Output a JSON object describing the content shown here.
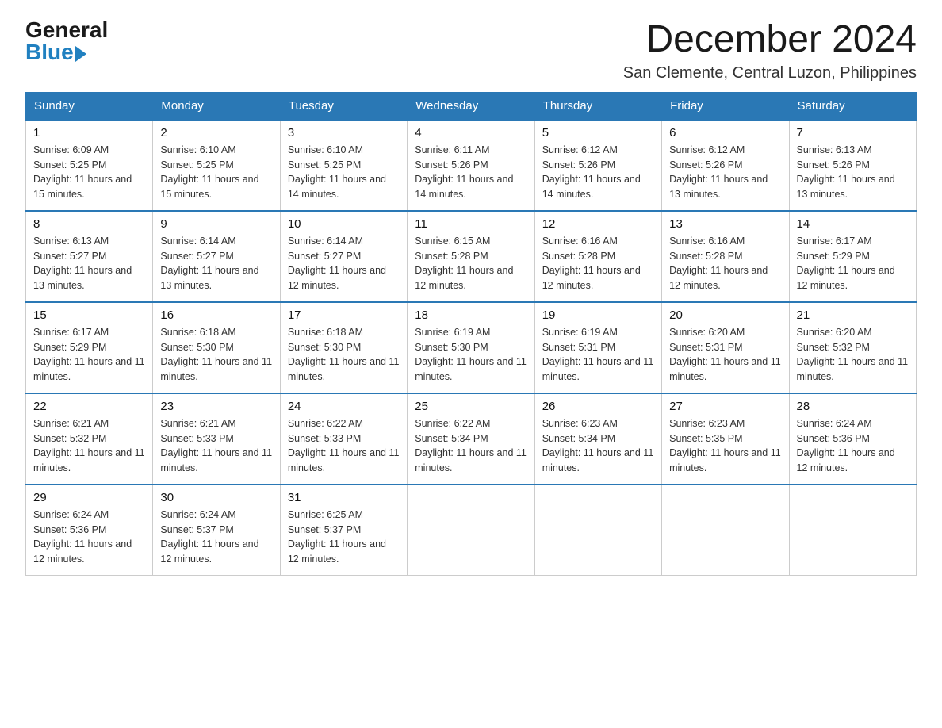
{
  "logo": {
    "general": "General",
    "blue": "Blue"
  },
  "header": {
    "month": "December 2024",
    "location": "San Clemente, Central Luzon, Philippines"
  },
  "weekdays": [
    "Sunday",
    "Monday",
    "Tuesday",
    "Wednesday",
    "Thursday",
    "Friday",
    "Saturday"
  ],
  "weeks": [
    [
      {
        "day": "1",
        "sunrise": "6:09 AM",
        "sunset": "5:25 PM",
        "daylight": "11 hours and 15 minutes."
      },
      {
        "day": "2",
        "sunrise": "6:10 AM",
        "sunset": "5:25 PM",
        "daylight": "11 hours and 15 minutes."
      },
      {
        "day": "3",
        "sunrise": "6:10 AM",
        "sunset": "5:25 PM",
        "daylight": "11 hours and 14 minutes."
      },
      {
        "day": "4",
        "sunrise": "6:11 AM",
        "sunset": "5:26 PM",
        "daylight": "11 hours and 14 minutes."
      },
      {
        "day": "5",
        "sunrise": "6:12 AM",
        "sunset": "5:26 PM",
        "daylight": "11 hours and 14 minutes."
      },
      {
        "day": "6",
        "sunrise": "6:12 AM",
        "sunset": "5:26 PM",
        "daylight": "11 hours and 13 minutes."
      },
      {
        "day": "7",
        "sunrise": "6:13 AM",
        "sunset": "5:26 PM",
        "daylight": "11 hours and 13 minutes."
      }
    ],
    [
      {
        "day": "8",
        "sunrise": "6:13 AM",
        "sunset": "5:27 PM",
        "daylight": "11 hours and 13 minutes."
      },
      {
        "day": "9",
        "sunrise": "6:14 AM",
        "sunset": "5:27 PM",
        "daylight": "11 hours and 13 minutes."
      },
      {
        "day": "10",
        "sunrise": "6:14 AM",
        "sunset": "5:27 PM",
        "daylight": "11 hours and 12 minutes."
      },
      {
        "day": "11",
        "sunrise": "6:15 AM",
        "sunset": "5:28 PM",
        "daylight": "11 hours and 12 minutes."
      },
      {
        "day": "12",
        "sunrise": "6:16 AM",
        "sunset": "5:28 PM",
        "daylight": "11 hours and 12 minutes."
      },
      {
        "day": "13",
        "sunrise": "6:16 AM",
        "sunset": "5:28 PM",
        "daylight": "11 hours and 12 minutes."
      },
      {
        "day": "14",
        "sunrise": "6:17 AM",
        "sunset": "5:29 PM",
        "daylight": "11 hours and 12 minutes."
      }
    ],
    [
      {
        "day": "15",
        "sunrise": "6:17 AM",
        "sunset": "5:29 PM",
        "daylight": "11 hours and 11 minutes."
      },
      {
        "day": "16",
        "sunrise": "6:18 AM",
        "sunset": "5:30 PM",
        "daylight": "11 hours and 11 minutes."
      },
      {
        "day": "17",
        "sunrise": "6:18 AM",
        "sunset": "5:30 PM",
        "daylight": "11 hours and 11 minutes."
      },
      {
        "day": "18",
        "sunrise": "6:19 AM",
        "sunset": "5:30 PM",
        "daylight": "11 hours and 11 minutes."
      },
      {
        "day": "19",
        "sunrise": "6:19 AM",
        "sunset": "5:31 PM",
        "daylight": "11 hours and 11 minutes."
      },
      {
        "day": "20",
        "sunrise": "6:20 AM",
        "sunset": "5:31 PM",
        "daylight": "11 hours and 11 minutes."
      },
      {
        "day": "21",
        "sunrise": "6:20 AM",
        "sunset": "5:32 PM",
        "daylight": "11 hours and 11 minutes."
      }
    ],
    [
      {
        "day": "22",
        "sunrise": "6:21 AM",
        "sunset": "5:32 PM",
        "daylight": "11 hours and 11 minutes."
      },
      {
        "day": "23",
        "sunrise": "6:21 AM",
        "sunset": "5:33 PM",
        "daylight": "11 hours and 11 minutes."
      },
      {
        "day": "24",
        "sunrise": "6:22 AM",
        "sunset": "5:33 PM",
        "daylight": "11 hours and 11 minutes."
      },
      {
        "day": "25",
        "sunrise": "6:22 AM",
        "sunset": "5:34 PM",
        "daylight": "11 hours and 11 minutes."
      },
      {
        "day": "26",
        "sunrise": "6:23 AM",
        "sunset": "5:34 PM",
        "daylight": "11 hours and 11 minutes."
      },
      {
        "day": "27",
        "sunrise": "6:23 AM",
        "sunset": "5:35 PM",
        "daylight": "11 hours and 11 minutes."
      },
      {
        "day": "28",
        "sunrise": "6:24 AM",
        "sunset": "5:36 PM",
        "daylight": "11 hours and 12 minutes."
      }
    ],
    [
      {
        "day": "29",
        "sunrise": "6:24 AM",
        "sunset": "5:36 PM",
        "daylight": "11 hours and 12 minutes."
      },
      {
        "day": "30",
        "sunrise": "6:24 AM",
        "sunset": "5:37 PM",
        "daylight": "11 hours and 12 minutes."
      },
      {
        "day": "31",
        "sunrise": "6:25 AM",
        "sunset": "5:37 PM",
        "daylight": "11 hours and 12 minutes."
      },
      null,
      null,
      null,
      null
    ]
  ],
  "labels": {
    "sunrise": "Sunrise:",
    "sunset": "Sunset:",
    "daylight": "Daylight:"
  }
}
